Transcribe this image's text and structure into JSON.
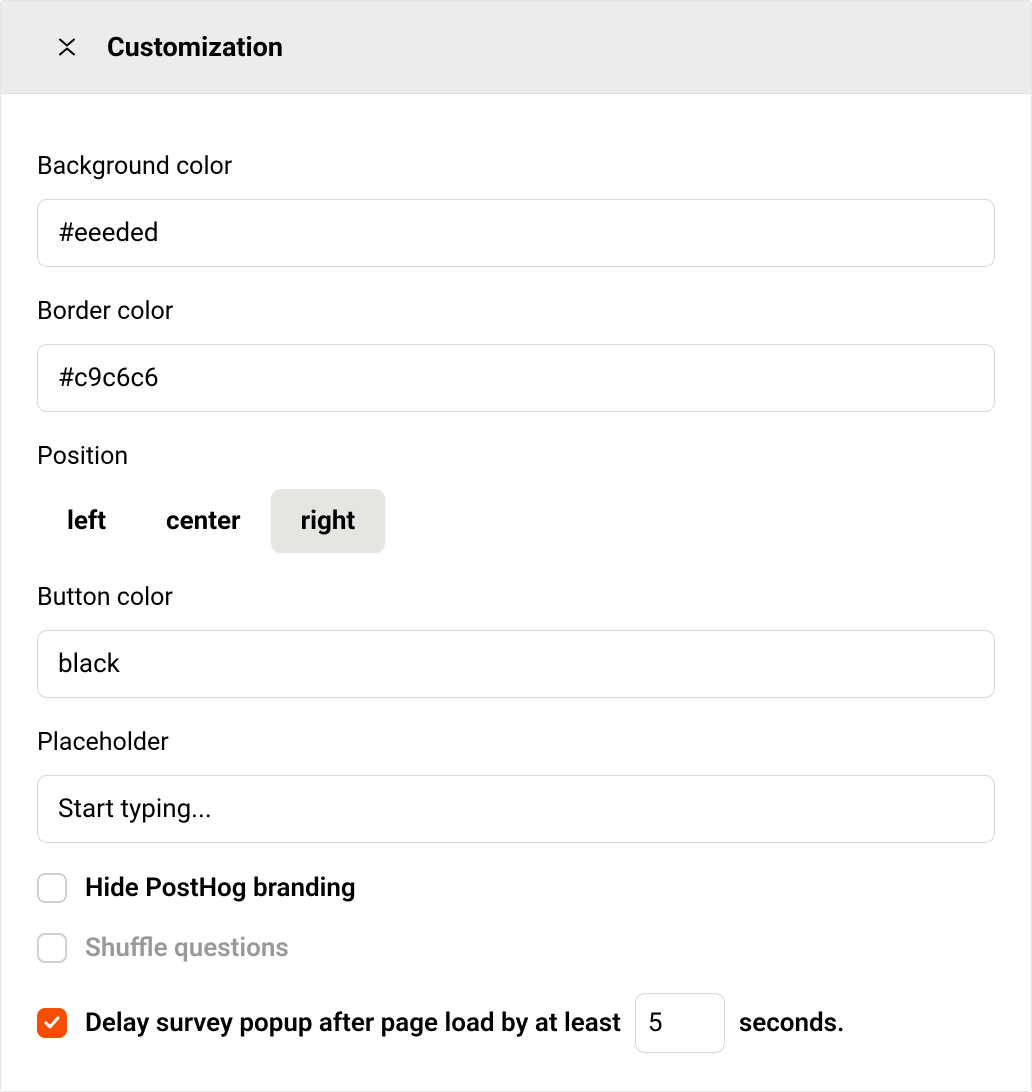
{
  "header": {
    "title": "Customization"
  },
  "fields": {
    "background_color": {
      "label": "Background color",
      "value": "#eeeded"
    },
    "border_color": {
      "label": "Border color",
      "value": "#c9c6c6"
    },
    "position": {
      "label": "Position",
      "options": [
        "left",
        "center",
        "right"
      ],
      "selected": "right"
    },
    "button_color": {
      "label": "Button color",
      "value": "black"
    },
    "placeholder": {
      "label": "Placeholder",
      "value": "Start typing..."
    },
    "hide_branding": {
      "label": "Hide PostHog branding",
      "checked": false
    },
    "shuffle_questions": {
      "label": "Shuffle questions",
      "checked": false,
      "disabled": true
    },
    "delay_popup": {
      "label_prefix": "Delay survey popup after page load by at least",
      "value": "5",
      "label_suffix": "seconds.",
      "checked": true
    }
  }
}
